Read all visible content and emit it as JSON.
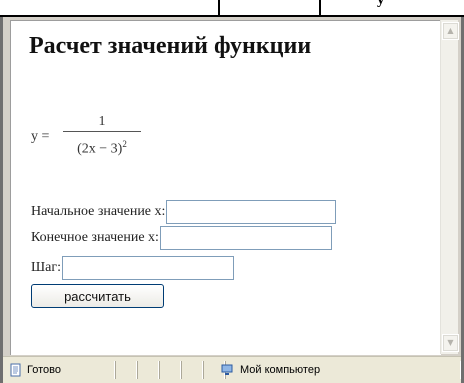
{
  "top_fragment": "у",
  "page": {
    "title": "Расчет значений функции",
    "formula": {
      "lhs": "y =",
      "numerator": "1",
      "denominator": "(2x − 3)",
      "exponent": "2"
    },
    "fields": {
      "start_label": "Начальное значение x:",
      "start_value": "",
      "end_label": "Конечное значение x:",
      "end_value": "",
      "step_label": "Шаг:",
      "step_value": ""
    },
    "calculate_label": "рассчитать"
  },
  "statusbar": {
    "status": "Готово",
    "zone": "Мой компьютер"
  },
  "colors": {
    "input_border": "#7f9db9",
    "button_border": "#003c74",
    "frame": "#d4d0c8"
  },
  "icons": [
    "page-icon",
    "computer-icon",
    "scroll-up-icon",
    "scroll-down-icon"
  ]
}
